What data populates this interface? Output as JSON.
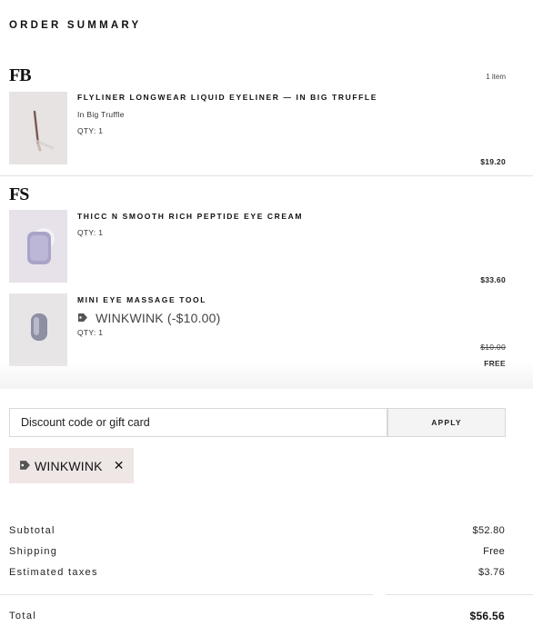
{
  "header": {
    "title": "ORDER SUMMARY"
  },
  "groups": [
    {
      "brand": "FB",
      "item_count": "1 item",
      "items": [
        {
          "name": "FLYLINER LONGWEAR LIQUID EYELINER — IN BIG TRUFFLE",
          "variant": "In Big Truffle",
          "qty": "QTY: 1",
          "price": "$19.20"
        }
      ]
    },
    {
      "brand": "FS",
      "items": [
        {
          "name": "THICC N SMOOTH RICH PEPTIDE EYE CREAM",
          "qty": "QTY: 1",
          "price": "$33.60"
        },
        {
          "name": "MINI EYE MASSAGE TOOL",
          "promo": "WINKWINK (-$10.00)",
          "qty": "QTY: 1",
          "original_price": "$10.00",
          "price": "FREE"
        }
      ]
    }
  ],
  "discount": {
    "placeholder": "Discount code or gift card",
    "apply_label": "APPLY",
    "applied_code": "WINKWINK",
    "remove_symbol": "✕"
  },
  "summary": {
    "subtotal_label": "Subtotal",
    "subtotal": "$52.80",
    "shipping_label": "Shipping",
    "shipping": "Free",
    "taxes_label": "Estimated taxes",
    "taxes": "$3.76",
    "total_label": "Total",
    "total": "$56.56"
  },
  "icons": {
    "tag": "tag-icon"
  },
  "colors": {
    "chip_bg": "#efe7e6",
    "thumb_bg": "#e9e6e5"
  }
}
